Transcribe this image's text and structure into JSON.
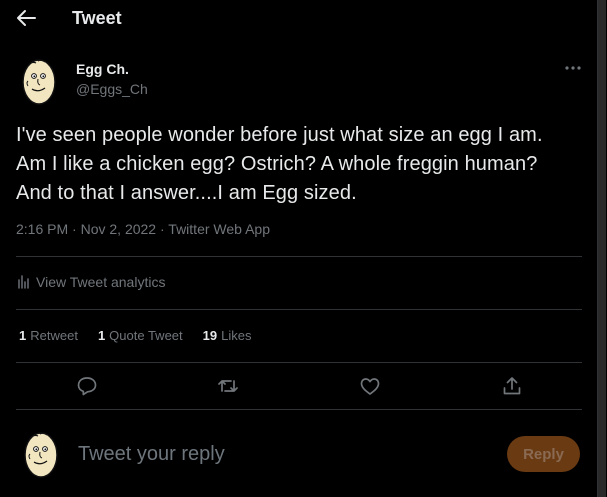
{
  "header": {
    "title": "Tweet",
    "back_icon": "arrow-left-icon"
  },
  "tweet": {
    "author_name": "Egg Ch.",
    "author_handle": "@Eggs_Ch",
    "text": "I've seen people wonder before just what size an egg I am. Am I like a chicken egg? Ostrich? A whole freggin human? And to that I answer....I am Egg sized.",
    "time": "2:16 PM",
    "date": "Nov 2, 2022",
    "source": "Twitter Web App",
    "separator": "·"
  },
  "analytics": {
    "label": "View Tweet analytics",
    "icon": "bar-chart-icon"
  },
  "stats": [
    {
      "count": "1",
      "label": "Retweet"
    },
    {
      "count": "1",
      "label": "Quote Tweet"
    },
    {
      "count": "19",
      "label": "Likes"
    }
  ],
  "actions": [
    "reply-icon",
    "retweet-icon",
    "like-icon",
    "share-icon"
  ],
  "reply": {
    "placeholder": "Tweet your reply",
    "button_label": "Reply"
  },
  "colors": {
    "background": "#000000",
    "text": "#e7e9ea",
    "muted": "#71767b",
    "divider": "#2f3336",
    "reply_button": "#6a3a12"
  }
}
